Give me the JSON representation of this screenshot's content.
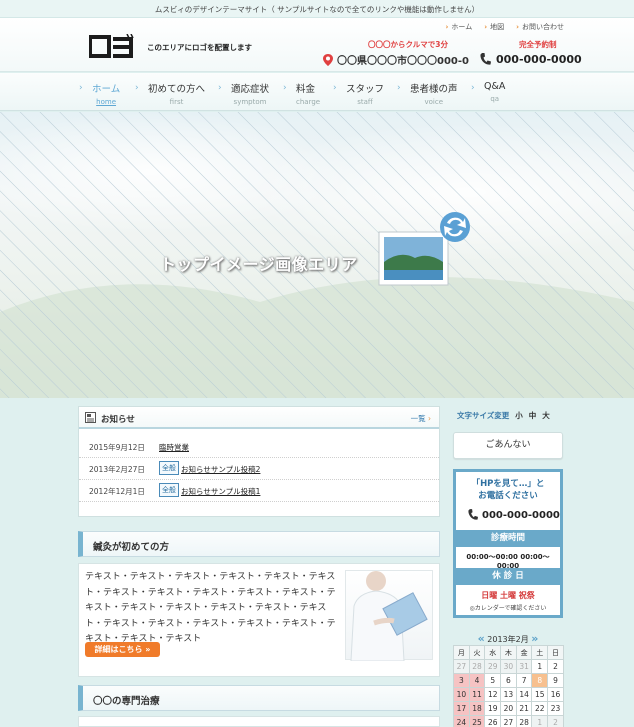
{
  "top": {
    "tagline": "ムスビィのデザインテーマサイト（ サンプルサイトなので全てのリンクや機能は動作しません）"
  },
  "header": {
    "links": [
      "ホーム",
      "地図",
      "お問い合わせ"
    ],
    "logo": "ロゴ",
    "logo_note": "このエリアにロゴを配置します",
    "access_note": "〇〇〇からクルマで3分",
    "address": "〇〇県〇〇〇市〇〇〇000-0",
    "reserve_note": "完全予約制",
    "phone": "000-000-0000"
  },
  "nav": [
    {
      "jp": "ホーム",
      "en": "home",
      "active": true
    },
    {
      "jp": "初めての方へ",
      "en": "first"
    },
    {
      "jp": "適応症状",
      "en": "symptom"
    },
    {
      "jp": "料金",
      "en": "charge"
    },
    {
      "jp": "スタッフ",
      "en": "staff"
    },
    {
      "jp": "患者様の声",
      "en": "voice"
    },
    {
      "jp": "Q&A",
      "en": "qa"
    }
  ],
  "hero": {
    "text": "トップイメージ画像エリア"
  },
  "news": {
    "title": "お知らせ",
    "more": "一覧",
    "items": [
      {
        "date": "2015年9月12日",
        "tag": "",
        "title": "臨時営業"
      },
      {
        "date": "2013年2月27日",
        "tag": "全般",
        "title": "お知らせサンプル投稿2"
      },
      {
        "date": "2012年12月1日",
        "tag": "全般",
        "title": "お知らせサンプル投稿1"
      }
    ]
  },
  "first": {
    "heading": "鍼灸が初めての方",
    "body": "テキスト・テキスト・テキスト・テキスト・テキスト・テキスト・テキスト・テキスト・テキスト・テキスト・テキスト・テキスト・テキスト・テキスト・テキスト・テキスト・テキスト・テキスト・テキスト・テキスト・テキスト・テキスト・テキスト・テキスト・テキスト",
    "button": "詳細はこちら »"
  },
  "special": {
    "heading": "〇〇の専門治療"
  },
  "sidebar": {
    "fontsize": {
      "label": "文字サイズ変更",
      "sizes": [
        "小",
        "中",
        "大"
      ]
    },
    "guide": "ごあんない",
    "contact": {
      "line1": "「HPを見て…」と",
      "line2": "お電話ください",
      "phone": "000-000-0000",
      "hours_label": "診療時間",
      "hours1": "00:00〜00:00 00:00〜00:00",
      "closed_label": "休 診 日",
      "closed_days": "日曜 土曜 祝祭",
      "calendar_note": "◎カレンダーで確認ください"
    },
    "calendar": {
      "title": "2013年2月",
      "weekdays": [
        "月",
        "火",
        "水",
        "木",
        "金",
        "土",
        "日"
      ],
      "rows": [
        [
          "27",
          "28",
          "29",
          "30",
          "31",
          "1",
          "2"
        ],
        [
          "3",
          "4",
          "5",
          "6",
          "7",
          "8",
          "9"
        ],
        [
          "10",
          "11",
          "12",
          "13",
          "14",
          "15",
          "16"
        ],
        [
          "17",
          "18",
          "19",
          "20",
          "21",
          "22",
          "23"
        ],
        [
          "24",
          "25",
          "26",
          "27",
          "28",
          "1",
          "2"
        ]
      ]
    }
  },
  "colors": {
    "accent": "#6aa9c9",
    "alert": "#e04040",
    "button": "#f07b2a"
  }
}
